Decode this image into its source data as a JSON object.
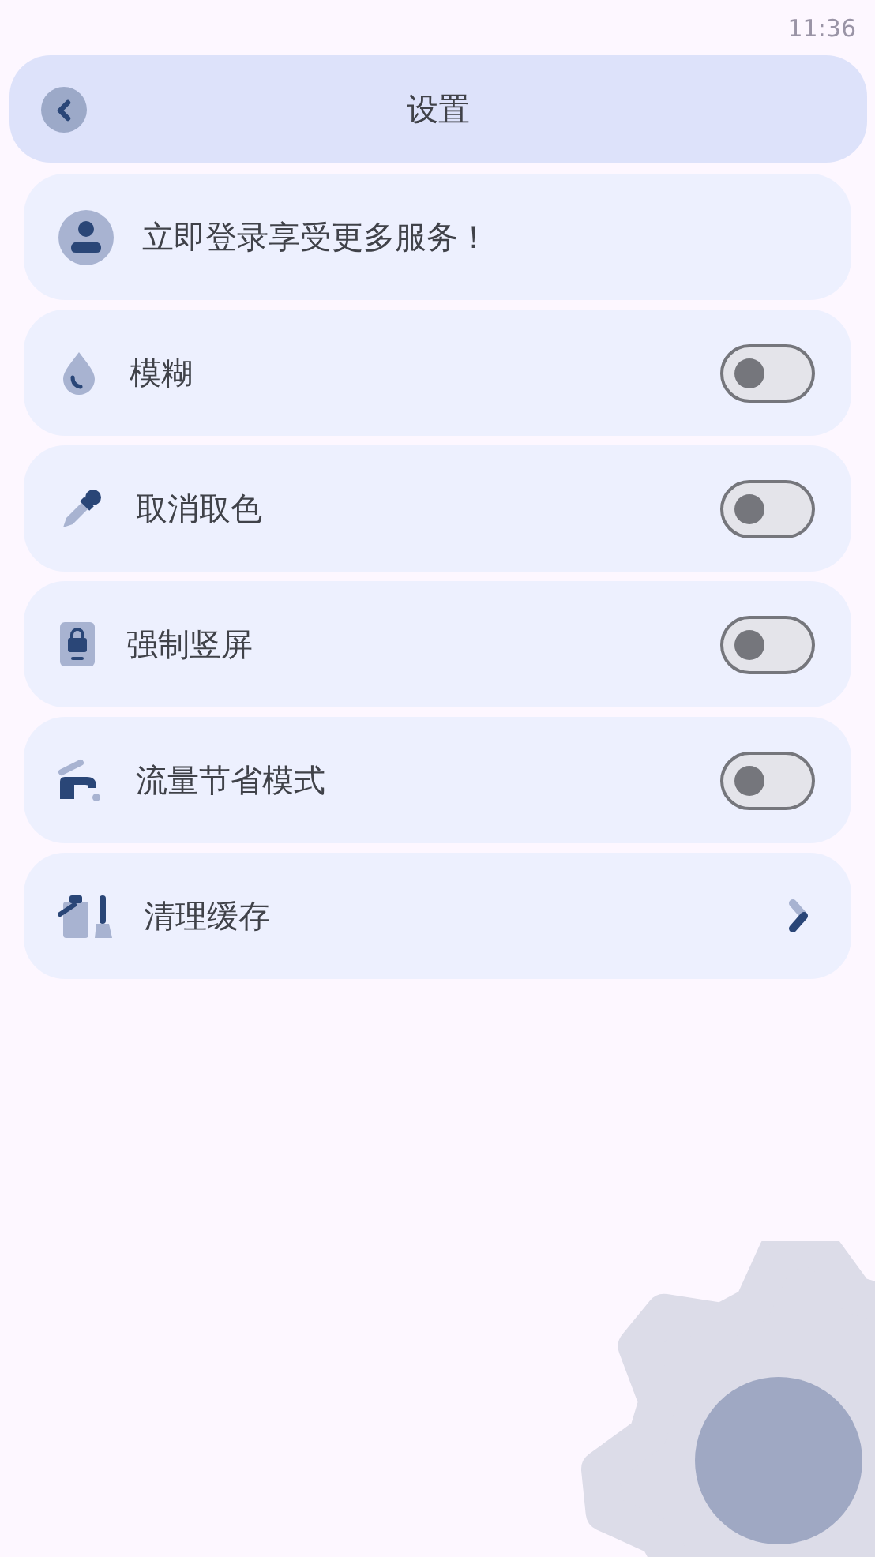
{
  "status_bar": {
    "time": "11:36"
  },
  "header": {
    "title": "设置"
  },
  "login": {
    "text": "立即登录享受更多服务！"
  },
  "settings": [
    {
      "kind": "toggle",
      "label": "模糊",
      "on": false
    },
    {
      "kind": "toggle",
      "label": "取消取色",
      "on": false
    },
    {
      "kind": "toggle",
      "label": "强制竖屏",
      "on": false
    },
    {
      "kind": "toggle",
      "label": "流量节省模式",
      "on": false
    },
    {
      "kind": "link",
      "label": "清理缓存"
    }
  ]
}
